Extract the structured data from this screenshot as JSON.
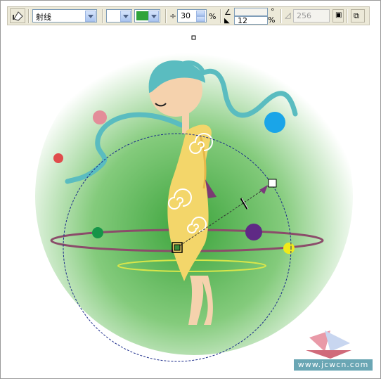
{
  "toolbar": {
    "fill_type": "射线",
    "color_swatch": "#2fa33a",
    "midpoint_value": "30",
    "midpoint_unit": "%",
    "angle_value": "",
    "angle_unit": "°",
    "edge_pad_value": "12",
    "edge_pad_unit": "%",
    "steps_value": "256"
  },
  "colors": {
    "sphere_center": "#3ca43c",
    "sphere_edge": "#ffffff",
    "hair": "#5abcc0",
    "face": "#f5d2ad",
    "dress": "#f3d66a",
    "ring": "#8b4c6a",
    "ring_yellow": "#d9e64a"
  },
  "dots": [
    {
      "name": "pink-dot",
      "color": "#e38d99"
    },
    {
      "name": "red-dot",
      "color": "#e04c4c"
    },
    {
      "name": "blue-dot",
      "color": "#1aa5e8"
    },
    {
      "name": "green-dot",
      "color": "#159548"
    },
    {
      "name": "purple-dot",
      "color": "#5f2a85"
    },
    {
      "name": "yellow-dot",
      "color": "#f0ea1a"
    }
  ],
  "watermark": "www.jcwcn.com"
}
